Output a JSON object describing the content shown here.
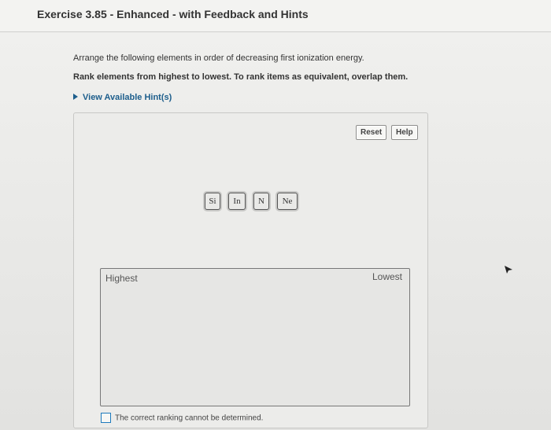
{
  "header": {
    "title": "Exercise 3.85 - Enhanced - with Feedback and Hints"
  },
  "question": {
    "prompt": "Arrange the following elements in order of decreasing first ionization energy.",
    "instructions": "Rank elements from highest to lowest. To rank items as equivalent, overlap them.",
    "hint_link": "View Available Hint(s)"
  },
  "toolbar": {
    "reset_label": "Reset",
    "help_label": "Help"
  },
  "tiles": [
    {
      "label": "Si"
    },
    {
      "label": "In"
    },
    {
      "label": "N"
    },
    {
      "label": "Ne"
    }
  ],
  "ranking": {
    "highest_label": "Highest",
    "lowest_label": "Lowest"
  },
  "checkbox": {
    "label": "The correct ranking cannot be determined.",
    "checked": false
  },
  "colors": {
    "hint_link": "#1d5e8c",
    "checkbox_border": "#1d7abd"
  }
}
